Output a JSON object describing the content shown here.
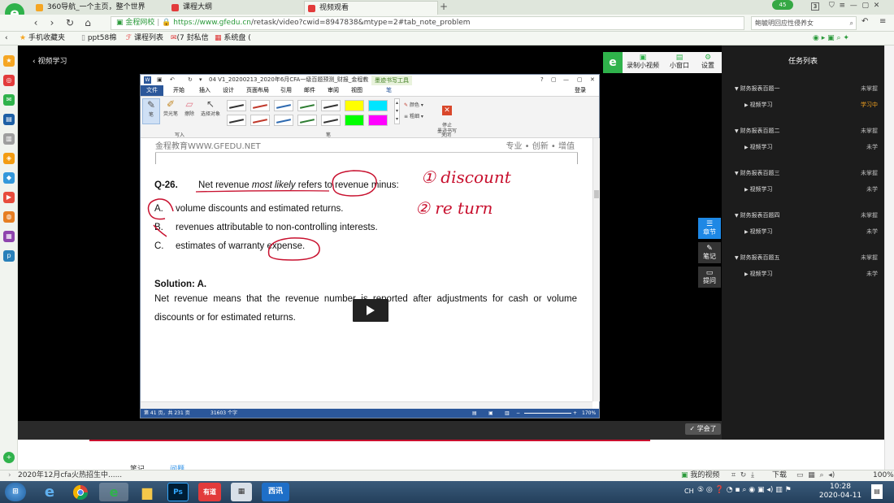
{
  "browser": {
    "tabs": [
      {
        "label": "360导航_一个主页，整个世界",
        "active": false
      },
      {
        "label": "课程大纲",
        "active": false
      },
      {
        "label": "视频观看",
        "active": true
      }
    ],
    "new_tab": "+",
    "badge": "45",
    "tab_count": "3",
    "url_site": "金程网校",
    "url_host": "https://www.gfedu.cn",
    "url_path": "/retask/video?cwid=8947838&mtype=2#tab_note_problem",
    "search_placeholder": "鲍毓明回应性侵养女",
    "bookmarks": [
      "手机收藏夹",
      "ppt58棉",
      "课程列表",
      "(7 封私信",
      "系统盘 ("
    ]
  },
  "player": {
    "back_label": "视频学习",
    "tools": {
      "record": "录制小视频",
      "mini": "小窗口",
      "settings": "设置"
    },
    "float_buttons": [
      "章节",
      "笔记",
      "提问"
    ],
    "learned_button": "学会了"
  },
  "word": {
    "title": "04 V1_20200213_2020年6月CFA一级百题预测_财报_金程教育...",
    "context_tab": "墨迹书写工具",
    "help": "?",
    "login": "登录",
    "tabs": [
      "文件",
      "开始",
      "插入",
      "设计",
      "页面布局",
      "引用",
      "邮件",
      "审阅",
      "视图",
      "笔"
    ],
    "ribbon": {
      "tools": [
        "笔",
        "荧光笔",
        "擦除",
        "选择对象"
      ],
      "group_write": "写入",
      "group_pen": "笔",
      "color": "颜色",
      "thickness": "粗细",
      "stop": "停止\n墨迹书写",
      "group_close": "关闭"
    },
    "pen_colors": [
      "#333333",
      "#c0392b",
      "#2e6ab0",
      "#2e7d32",
      "#333333",
      "#ffff00",
      "#00e5ff",
      "#333333",
      "#c0392b",
      "#2e6ab0",
      "#2e7d32",
      "#333333",
      "#00ff00",
      "#ff00ff"
    ],
    "status": {
      "page": "第 41 页，共 231 页",
      "words": "31603 个字",
      "zoom": "170%"
    }
  },
  "doc": {
    "letterhead_left": "金程教育WWW.GFEDU.NET",
    "letterhead_right": "专业 • 创新 • 增值",
    "question_num": "Q-26.",
    "question_a": "Net revenue ",
    "question_b": "most likely",
    "question_c": " refers to revenue minus:",
    "options": [
      {
        "key": "A.",
        "text": "volume discounts and estimated returns."
      },
      {
        "key": "B.",
        "text": "revenues attributable to non-controlling interests."
      },
      {
        "key": "C.",
        "text": "estimates of warranty expense."
      }
    ],
    "solution_label": "Solution: A.",
    "explanation": "Net revenue means that the revenue number is reported after adjustments for cash or volume discounts or for estimated returns.",
    "annotations": [
      "① discount",
      "② re turn"
    ]
  },
  "tasks": {
    "title": "任务列表",
    "chapters": [
      {
        "name": "财务报表百题一",
        "status": "未掌握",
        "item": "视频学习",
        "item_status": "学习中"
      },
      {
        "name": "财务报表百题二",
        "status": "未掌握",
        "item": "视频学习",
        "item_status": "未学"
      },
      {
        "name": "财务报表百题三",
        "status": "未掌握",
        "item": "视频学习",
        "item_status": "未学"
      },
      {
        "name": "财务报表百题四",
        "status": "未掌握",
        "item": "视频学习",
        "item_status": "未学"
      },
      {
        "name": "财务报表百题五",
        "status": "未掌握",
        "item": "视频学习",
        "item_status": "未学"
      }
    ]
  },
  "page_tabs": [
    "笔记",
    "问题"
  ],
  "statusbar": {
    "ticker": "2020年12月cfa火热招生中......",
    "my_video": "我的视频",
    "download": "下载",
    "zoom": "100%"
  },
  "taskbar": {
    "apps": [
      "",
      "",
      "",
      "",
      "",
      "Ps",
      "有道",
      "",
      "西讯"
    ],
    "ime": "CH",
    "time": "10:28",
    "date": "2020-04-11"
  }
}
